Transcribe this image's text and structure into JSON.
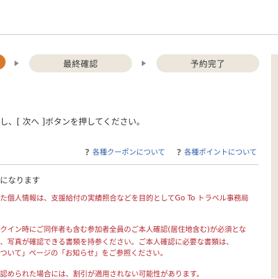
{
  "steps": {
    "confirm_label": "最終確認",
    "complete_label": "予約完了"
  },
  "colors": {
    "accent": "#d97a2a",
    "pill_bg": "#ece6dd",
    "link": "#2e5fa8",
    "warning": "#b3262e"
  },
  "instruction": "し、[ 次へ ]ボタンを押してください。",
  "help_links": [
    {
      "icon": "question-icon",
      "symbol": "?",
      "label": "各種クーポンについて"
    },
    {
      "icon": "question-icon",
      "symbol": "?",
      "label": "各種ポイントについて"
    }
  ],
  "notice": {
    "heading": "になります",
    "lines": [
      "た個人情報は、支援給付の実績照合などを目的としてGo To トラベル事務局",
      "クイン時にご同伴者も含む参加者全員のご本人確認(居住地含む)が必須とな",
      "、写真が確認できる書類を持参ください。ご本人確認に必要な書類は、",
      "ついて」ページの「お知らせ」をご参照ください。",
      "認められた場合には、割引が適用されない可能性があります。"
    ]
  }
}
